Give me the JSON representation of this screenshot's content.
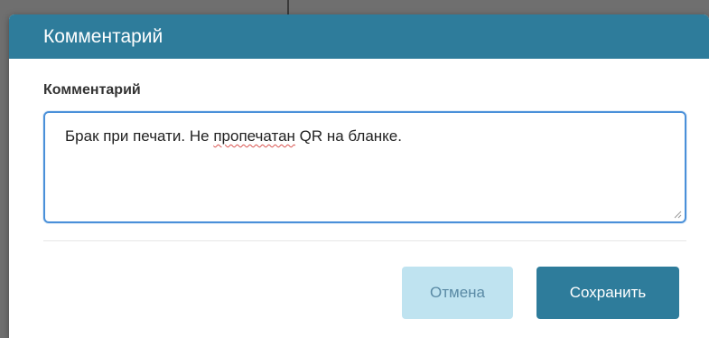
{
  "dialog": {
    "title": "Комментарий",
    "field_label": "Комментарий",
    "comment": {
      "before": "Брак при печати. Не ",
      "misspelled": "пропечатан",
      "after": " QR на бланке."
    },
    "buttons": {
      "cancel_label": "Отмена",
      "save_label": "Сохранить"
    }
  },
  "colors": {
    "header": "#2e7c9b",
    "save_button": "#2e7c9b",
    "cancel_button": "#bfe3f0",
    "focus_border": "#4a90d9"
  },
  "icons": {
    "resize": "resize-handle-icon"
  }
}
